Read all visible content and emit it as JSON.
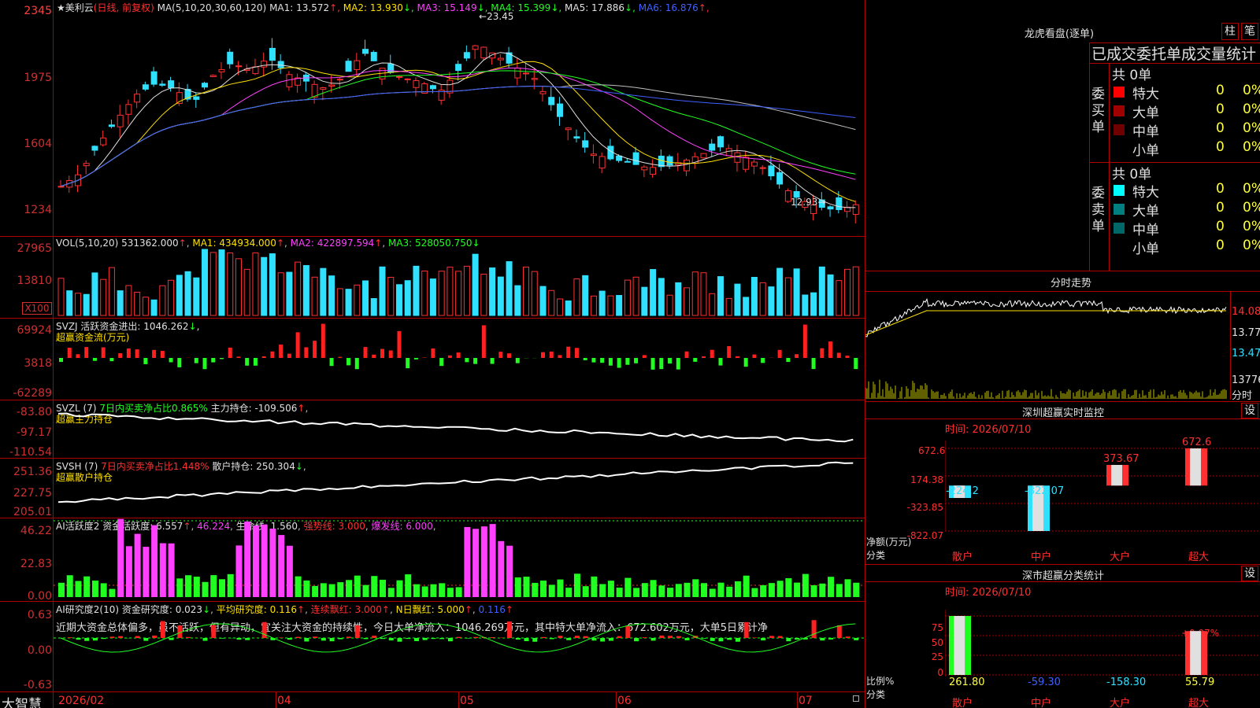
{
  "stock": {
    "star": "★",
    "name": "美利云",
    "period": "(日线, 前复权)"
  },
  "ma_header": {
    "label": "MA(5,10,20,30,60,120)",
    "items": [
      {
        "name": "MA1:",
        "value": "13.572",
        "arrow": "↑",
        "color": "#e0e0e0",
        "arrow_color": "#ff3030"
      },
      {
        "name": "MA2:",
        "value": "13.930",
        "arrow": "↓",
        "color": "#ffe000",
        "arrow_color": "#20ff20"
      },
      {
        "name": "MA3:",
        "value": "15.149",
        "arrow": "↓",
        "color": "#ff40ff",
        "arrow_color": "#20ff20"
      },
      {
        "name": "MA4:",
        "value": "15.399",
        "arrow": "↓",
        "color": "#20ff20",
        "arrow_color": "#20ff20"
      },
      {
        "name": "MA5:",
        "value": "17.886",
        "arrow": "↓",
        "color": "#e0e0e0",
        "arrow_color": "#20ff20"
      },
      {
        "name": "MA6:",
        "value": "16.876",
        "arrow": "↑",
        "color": "#4060ff",
        "arrow_color": "#ff3030"
      }
    ]
  },
  "price_axis": [
    "2345",
    "1975",
    "1604",
    "1234"
  ],
  "price_marks": {
    "high": "23.45",
    "low": "12.93"
  },
  "vol_header": {
    "label": "VOL(5,10,20)",
    "vol": "531362.000",
    "vol_arrow": "↑",
    "ma1": "MA1: 434934.000",
    "ma1_arrow": "↑",
    "ma2": "MA2: 422897.594",
    "ma2_arrow": "↑",
    "ma3": "MA3: 528050.750",
    "ma3_arrow": "↓"
  },
  "vol_axis": [
    "27965",
    "13810"
  ],
  "vol_unit": "X100",
  "svzj": {
    "label": "SVZJ  活跃资金进出: 1046.262",
    "arrow": "↓",
    "sub": "超赢资金流(万元)",
    "axis": [
      "69924",
      "3818",
      "-62289"
    ]
  },
  "svzl": {
    "label": "SVZL (7)",
    "ratio": "7日内买卖净占比0.865%",
    "hold": "主力持仓: -109.506",
    "arrow": "↑",
    "sub": "超赢主力持仓",
    "axis": [
      "-83.80",
      "-97.17",
      "-110.54"
    ]
  },
  "svsh": {
    "label": "SVSH (7)",
    "ratio": "7日内买卖净占比1.448%",
    "hold": "散户持仓: 250.304",
    "arrow": "↓",
    "sub": "超赢散户持仓",
    "axis": [
      "251.36",
      "227.75",
      "205.01"
    ]
  },
  "ai1": {
    "label": "AI活跃度2",
    "a": "资金活跃度: 6.557",
    "a_arrow": "↑",
    "b": "46.224",
    "c": "生命线: 1.560",
    "d": "强势线: 3.000",
    "e": "爆发线: 6.000",
    "axis": [
      "46.22",
      "22.83",
      "0.00"
    ]
  },
  "ai2": {
    "label": "AI研究度2(10)",
    "a": "资金研究度: 0.023",
    "a_arrow": "↓",
    "b": "平均研究度: 0.116",
    "b_arrow": "↑",
    "c": "连续飘红: 3.000",
    "c_arrow": "↑",
    "d": "N日飘红: 5.000",
    "d_arrow": "↑",
    "e": "0.116",
    "e_arrow": "↑",
    "text": "近期大资金总体偏多，虽不活跃，但有异动，宜关注大资金的持续性，今日大单净流入：1046.269万元，其中特大单净流入：672.602万元，大单5日累计净",
    "axis": [
      "0.63",
      "0.00",
      "-0.63"
    ]
  },
  "xaxis": [
    "2026/02",
    "04",
    "05",
    "06",
    "07"
  ],
  "brand": "大智慧",
  "right": {
    "lhb_title": "龙虎看盘(逐单)",
    "btn_bar": "柱",
    "btn_pen": "笔",
    "stat_title": "已成交委托单成交量统计",
    "buy_label": "委买单",
    "sell_label": "委卖单",
    "buy_total": "共 0单",
    "sell_total": "共 0单",
    "buy_rows": [
      {
        "name": "特大",
        "n": "0",
        "p": "0%",
        "color": "#ff0000"
      },
      {
        "name": "大单",
        "n": "0",
        "p": "0%",
        "color": "#a00000"
      },
      {
        "name": "中单",
        "n": "0",
        "p": "0%",
        "color": "#700000"
      },
      {
        "name": "小单",
        "n": "0",
        "p": "0%",
        "color": "#000000"
      }
    ],
    "sell_rows": [
      {
        "name": "特大",
        "n": "0",
        "p": "0%",
        "color": "#00ffff"
      },
      {
        "name": "大单",
        "n": "0",
        "p": "0%",
        "color": "#008080"
      },
      {
        "name": "中单",
        "n": "0",
        "p": "0%",
        "color": "#006868"
      },
      {
        "name": "小单",
        "n": "0",
        "p": "0%",
        "color": "#000000"
      }
    ],
    "fs_title": "分时走势",
    "fs_axis": [
      "14.08",
      "13.77",
      "13.47",
      "13776"
    ],
    "fs_unit": "分时",
    "sz_title": "深圳超赢实时监控",
    "sz_set": "设",
    "sz_time": "时间: 2026/07/10",
    "sz_axis": [
      "672.6",
      "174.38",
      "-323.85",
      "-822.07"
    ],
    "sz_ylabel": "净额(万元)",
    "sz_xlabel": "分类",
    "cls_title": "深市超赢分类统计",
    "cls_set": "设",
    "cls_time": "时间: 2026/07/10",
    "cls_axis": [
      "75",
      "50",
      "25",
      "0"
    ],
    "cls_ylabel": "比例%",
    "cls_xlabel": "分类",
    "cls_note": "+0.07%"
  },
  "chart_data": [
    {
      "type": "bar",
      "title": "深圳超赢实时监控",
      "ylabel": "净额(万元)",
      "xlabel": "分类",
      "categories": [
        "散户",
        "中户",
        "大户",
        "超大"
      ],
      "values": [
        -224.2,
        -822.07,
        373.67,
        672.6
      ],
      "ylim": [
        -822.07,
        672.6
      ]
    },
    {
      "type": "bar",
      "title": "深市超赢分类统计",
      "ylabel": "比例%",
      "xlabel": "分类",
      "categories": [
        "散户",
        "中户",
        "大户",
        "超大"
      ],
      "values": [
        261.8,
        -59.3,
        -158.3,
        55.79
      ],
      "ylim": [
        0,
        75
      ]
    }
  ]
}
